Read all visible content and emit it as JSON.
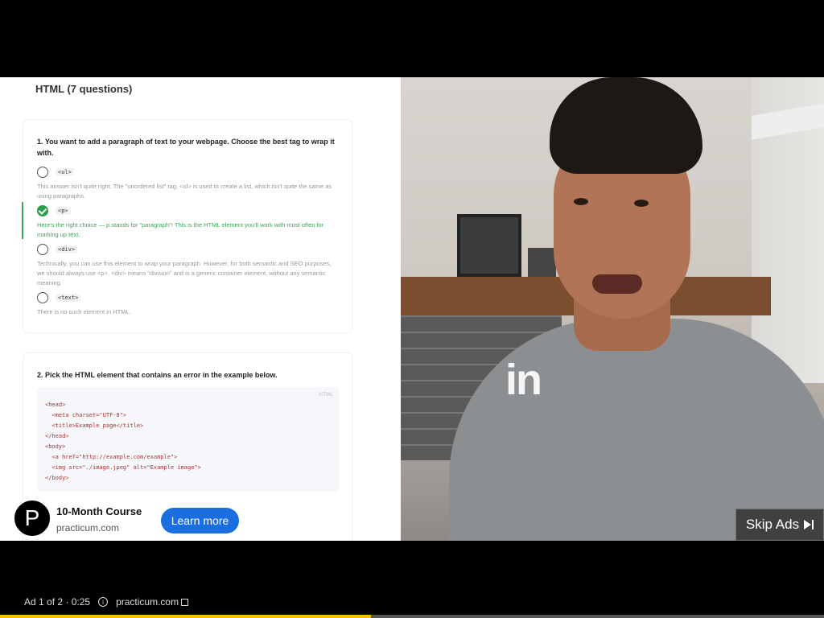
{
  "quiz": {
    "title": "HTML (7 questions)",
    "q1": {
      "text": "1. You want to add a paragraph of text to your webpage. Choose the best tag to wrap it with.",
      "options": [
        {
          "tag": "<ul>",
          "explanation": "This answer isn't quite right. The \"unordered list\" tag, <ul> is used to create a list, which isn't quite the same as using paragraphs.",
          "correct": false
        },
        {
          "tag": "<p>",
          "explanation": "Here's the right choice — p stands for \"paragraph\"! This is the HTML element you'll work with most often for marking up text.",
          "correct": true
        },
        {
          "tag": "<div>",
          "explanation": "Technically, you can use this element to wrap your paragraph. However, for both semantic and SEO purposes, we should always use <p>. <div> means \"division\" and is a generic container element, without any semantic meaning.",
          "correct": false
        },
        {
          "tag": "<text>",
          "explanation": "There is no such element in HTML.",
          "correct": false
        }
      ]
    },
    "q2": {
      "text": "2. Pick the HTML element that contains an error in the example below.",
      "code_lang": "HTML",
      "code_lines": [
        "<head>",
        "  <meta charset=\"UTF-8\">",
        "  <title>Example page</title>",
        "</head>",
        "<body>",
        "  <a href=\"http://example.com/example\">",
        "  <img src=\"./image.jpeg\" alt=\"Example image\">",
        "</body>"
      ]
    }
  },
  "video": {
    "logo_text": "in"
  },
  "skip": {
    "label": "Skip Ads"
  },
  "ad": {
    "avatar_letter": "P",
    "title": "10-Month Course",
    "domain": "practicum.com",
    "cta": "Learn more"
  },
  "bottom": {
    "ad_count": "Ad 1 of 2 · 0:25",
    "link": "practicum.com",
    "progress": 0.45
  }
}
